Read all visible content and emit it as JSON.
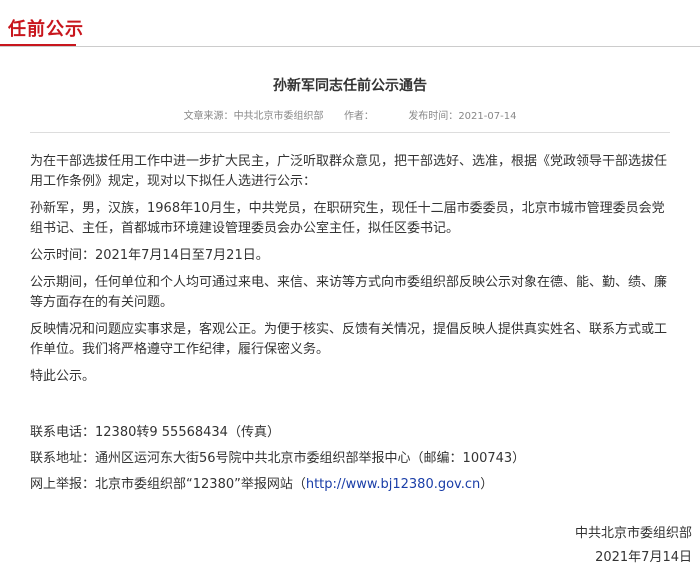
{
  "header": {
    "section_label": "任前公示"
  },
  "article": {
    "title": "孙新军同志任前公示通告",
    "meta": {
      "source_label": "文章来源：",
      "source": "中共北京市委组织部",
      "author_label": "作者：",
      "author": "",
      "date_label": "发布时间：",
      "date": "2021-07-14"
    },
    "paragraphs": [
      "为在干部选拔任用工作中进一步扩大民主，广泛听取群众意见，把干部选好、选准，根据《党政领导干部选拔任用工作条例》规定，现对以下拟任人选进行公示：",
      "孙新军，男，汉族，1968年10月生，中共党员，在职研究生，现任十二届市委委员，北京市城市管理委员会党组书记、主任，首都城市环境建设管理委员会办公室主任，拟任区委书记。",
      "公示时间：2021年7月14日至7月21日。",
      "公示期间，任何单位和个人均可通过来电、来信、来访等方式向市委组织部反映公示对象在德、能、勤、绩、廉等方面存在的有关问题。",
      "反映情况和问题应实事求是，客观公正。为便于核实、反馈有关情况，提倡反映人提供真实姓名、联系方式或工作单位。我们将严格遵守工作纪律，履行保密义务。",
      "特此公示。"
    ],
    "contact": {
      "phone_label": "联系电话：",
      "phone": "12380转9 55568434（传真）",
      "address_label": "联系地址：",
      "address": "通州区运河东大街56号院中共北京市委组织部举报中心（邮编：100743）",
      "online_label": "网上举报：",
      "online_text": "北京市委组织部“12380”举报网站（",
      "online_url": "http://www.bj12380.gov.cn",
      "online_close": "）"
    },
    "signoff": {
      "org": "中共北京市委组织部",
      "date": "2021年7月14日"
    }
  }
}
